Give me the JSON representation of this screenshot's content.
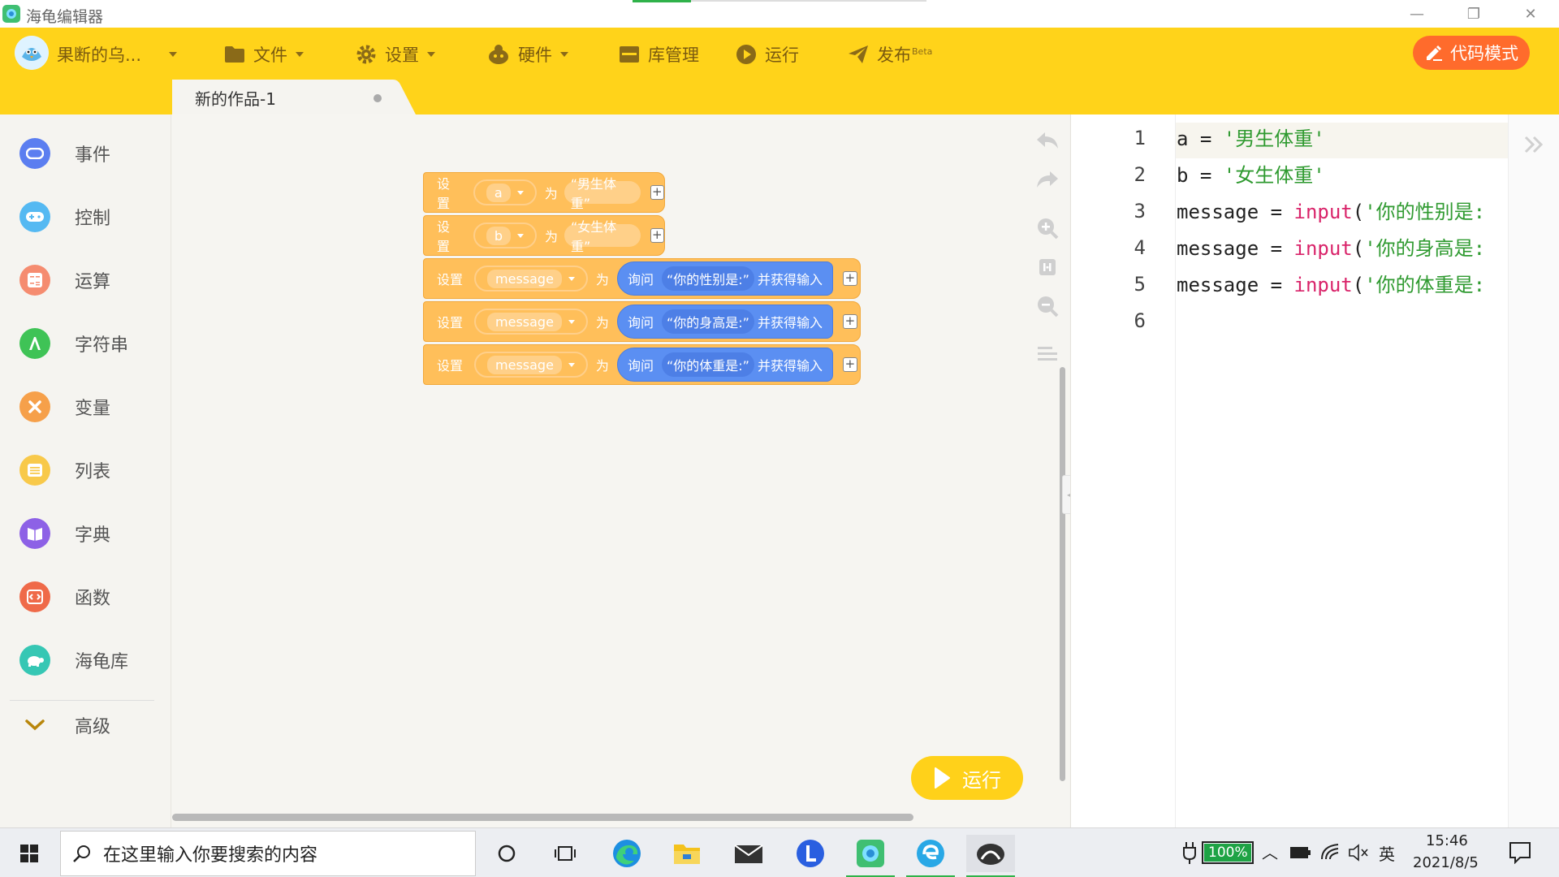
{
  "window": {
    "title": "海龟编辑器",
    "controls": {
      "minimize": "—",
      "restore": "❐",
      "close": "✕"
    }
  },
  "header": {
    "user_name": "果断的乌...",
    "menu": [
      {
        "label": "文件",
        "icon": "folder-icon"
      },
      {
        "label": "设置",
        "icon": "gear-icon"
      },
      {
        "label": "硬件",
        "icon": "hardware-icon"
      },
      {
        "label": "库管理",
        "icon": "library-icon"
      },
      {
        "label": "运行",
        "icon": "play-circle-icon"
      },
      {
        "label": "发布",
        "badge": "Beta",
        "icon": "send-icon"
      }
    ],
    "code_mode_label": "代码模式",
    "accent": "#ffd31a",
    "code_mode_color": "#ff6b2c"
  },
  "project_tab": {
    "label": "新的作品-1"
  },
  "sidebar": {
    "categories": [
      {
        "label": "事件",
        "color": "#5b7ef0"
      },
      {
        "label": "控制",
        "color": "#55b9f2"
      },
      {
        "label": "运算",
        "color": "#f58c70"
      },
      {
        "label": "字符串",
        "color": "#3fc356"
      },
      {
        "label": "变量",
        "color": "#f6a04a"
      },
      {
        "label": "列表",
        "color": "#f8c94a"
      },
      {
        "label": "字典",
        "color": "#8d61e6"
      },
      {
        "label": "函数",
        "color": "#ef6a49"
      },
      {
        "label": "海龟库",
        "color": "#36c7b4"
      }
    ],
    "advanced_label": "高级"
  },
  "blocks": [
    {
      "keyword": "设置",
      "var": "a",
      "wei": "为",
      "value": "“男生体重”"
    },
    {
      "keyword": "设置",
      "var": "b",
      "wei": "为",
      "value": "“女生体重”"
    },
    {
      "keyword": "设置",
      "var": "message",
      "wei": "为",
      "ask": "询问",
      "prompt": "“你的性别是:”",
      "suffix": "并获得输入"
    },
    {
      "keyword": "设置",
      "var": "message",
      "wei": "为",
      "ask": "询问",
      "prompt": "“你的身高是:”",
      "suffix": "并获得输入"
    },
    {
      "keyword": "设置",
      "var": "message",
      "wei": "为",
      "ask": "询问",
      "prompt": "“你的体重是:”",
      "suffix": "并获得输入"
    }
  ],
  "run_button": {
    "label": "运行"
  },
  "code": {
    "line_numbers": [
      "1",
      "2",
      "3",
      "4",
      "5",
      "6"
    ],
    "lines": [
      [
        {
          "t": "id",
          "v": "a = "
        },
        {
          "t": "str",
          "v": "'男生体重'"
        }
      ],
      [
        {
          "t": "id",
          "v": "b = "
        },
        {
          "t": "str",
          "v": "'女生体重'"
        }
      ],
      [
        {
          "t": "id",
          "v": "message = "
        },
        {
          "t": "fn",
          "v": "input"
        },
        {
          "t": "id",
          "v": "("
        },
        {
          "t": "str",
          "v": "'你的性别是:"
        }
      ],
      [
        {
          "t": "id",
          "v": "message = "
        },
        {
          "t": "fn",
          "v": "input"
        },
        {
          "t": "id",
          "v": "("
        },
        {
          "t": "str",
          "v": "'你的身高是:"
        }
      ],
      [
        {
          "t": "id",
          "v": "message = "
        },
        {
          "t": "fn",
          "v": "input"
        },
        {
          "t": "id",
          "v": "("
        },
        {
          "t": "str",
          "v": "'你的体重是:"
        }
      ],
      []
    ]
  },
  "taskbar": {
    "search_placeholder": "在这里输入你要搜索的内容",
    "battery": "100%",
    "ime": "英",
    "time": "15:46",
    "date": "2021/8/5"
  }
}
